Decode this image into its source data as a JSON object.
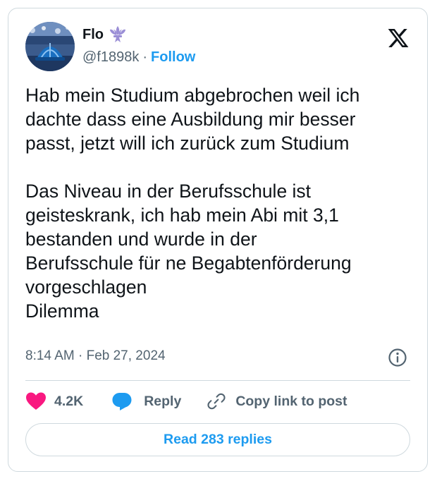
{
  "user": {
    "display_name": "Flo",
    "handle": "@f1898k",
    "separator": "·",
    "follow_label": "Follow"
  },
  "tweet": {
    "text": "Hab mein Studium abgebrochen weil ich\ndachte dass eine Ausbildung mir besser\npasst, jetzt will ich zurück zum Studium\n\nDas Niveau in der Berufsschule ist\ngeisteskrank, ich hab mein Abi mit 3,1\nbestanden und wurde in der\nBerufsschule für ne Begabtenförderung\nvorgeschlagen\nDilemma",
    "timestamp": "8:14 AM · Feb 27, 2024"
  },
  "actions": {
    "likes": "4.2K",
    "reply_label": "Reply",
    "copy_label": "Copy link to post"
  },
  "read_replies_label": "Read 283 replies",
  "colors": {
    "accent": "#1d9bf0",
    "heart": "#f91880",
    "text": "#0f1419",
    "muted": "#536471",
    "fleur": "#9b8fd6"
  },
  "icons": [
    "fleur-de-lis-icon",
    "x-logo-icon",
    "info-icon",
    "heart-icon",
    "reply-bubble-icon",
    "link-icon"
  ]
}
